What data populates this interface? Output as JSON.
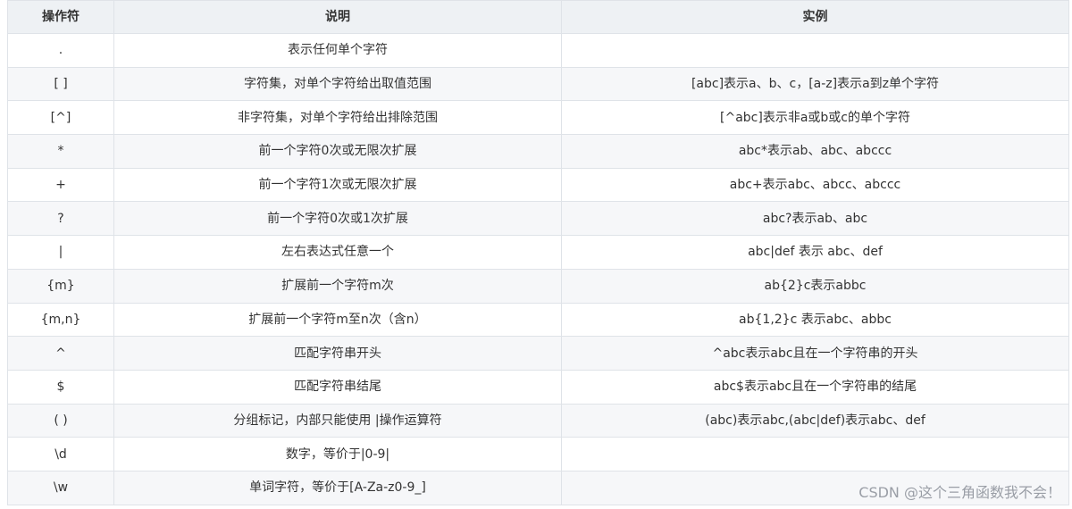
{
  "table": {
    "headers": [
      "操作符",
      "说明",
      "实例"
    ],
    "rows": [
      {
        "op": ".",
        "desc": "表示任何单个字符",
        "example": ""
      },
      {
        "op": "[ ]",
        "desc": "字符集，对单个字符给出取值范围",
        "example": "[abc]表示a、b、c，[a-z]表示a到z单个字符"
      },
      {
        "op": "[^]",
        "desc": "非字符集，对单个字符给出排除范围",
        "example": "[^abc]表示非a或b或c的单个字符"
      },
      {
        "op": "*",
        "desc": "前一个字符0次或无限次扩展",
        "example": "abc*表示ab、abc、abccc"
      },
      {
        "op": "+",
        "desc": "前一个字符1次或无限次扩展",
        "example": "abc+表示abc、abcc、abccc"
      },
      {
        "op": "?",
        "desc": "前一个字符0次或1次扩展",
        "example": "abc?表示ab、abc"
      },
      {
        "op": "|",
        "desc": "左右表达式任意一个",
        "example": "abc|def 表示 abc、def"
      },
      {
        "op": "{m}",
        "desc": "扩展前一个字符m次",
        "example": "ab{2}c表示abbc"
      },
      {
        "op": "{m,n}",
        "desc": "扩展前一个字符m至n次（含n）",
        "example": "ab{1,2}c 表示abc、abbc"
      },
      {
        "op": "^",
        "desc": "匹配字符串开头",
        "example": "^abc表示abc且在一个字符串的开头"
      },
      {
        "op": "$",
        "desc": "匹配字符串结尾",
        "example": "abc$表示abc且在一个字符串的结尾"
      },
      {
        "op": "( )",
        "desc": "分组标记，内部只能使用 |操作运算符",
        "example": "(abc)表示abc,(abc|def)表示abc、def"
      },
      {
        "op": "\\d",
        "desc": "数字，等价于|0-9|",
        "example": ""
      },
      {
        "op": "\\w",
        "desc": "单词字符，等价于[A-Za-z0-9_]",
        "example": ""
      }
    ]
  },
  "watermark": "CSDN @这个三角函数我不会！"
}
